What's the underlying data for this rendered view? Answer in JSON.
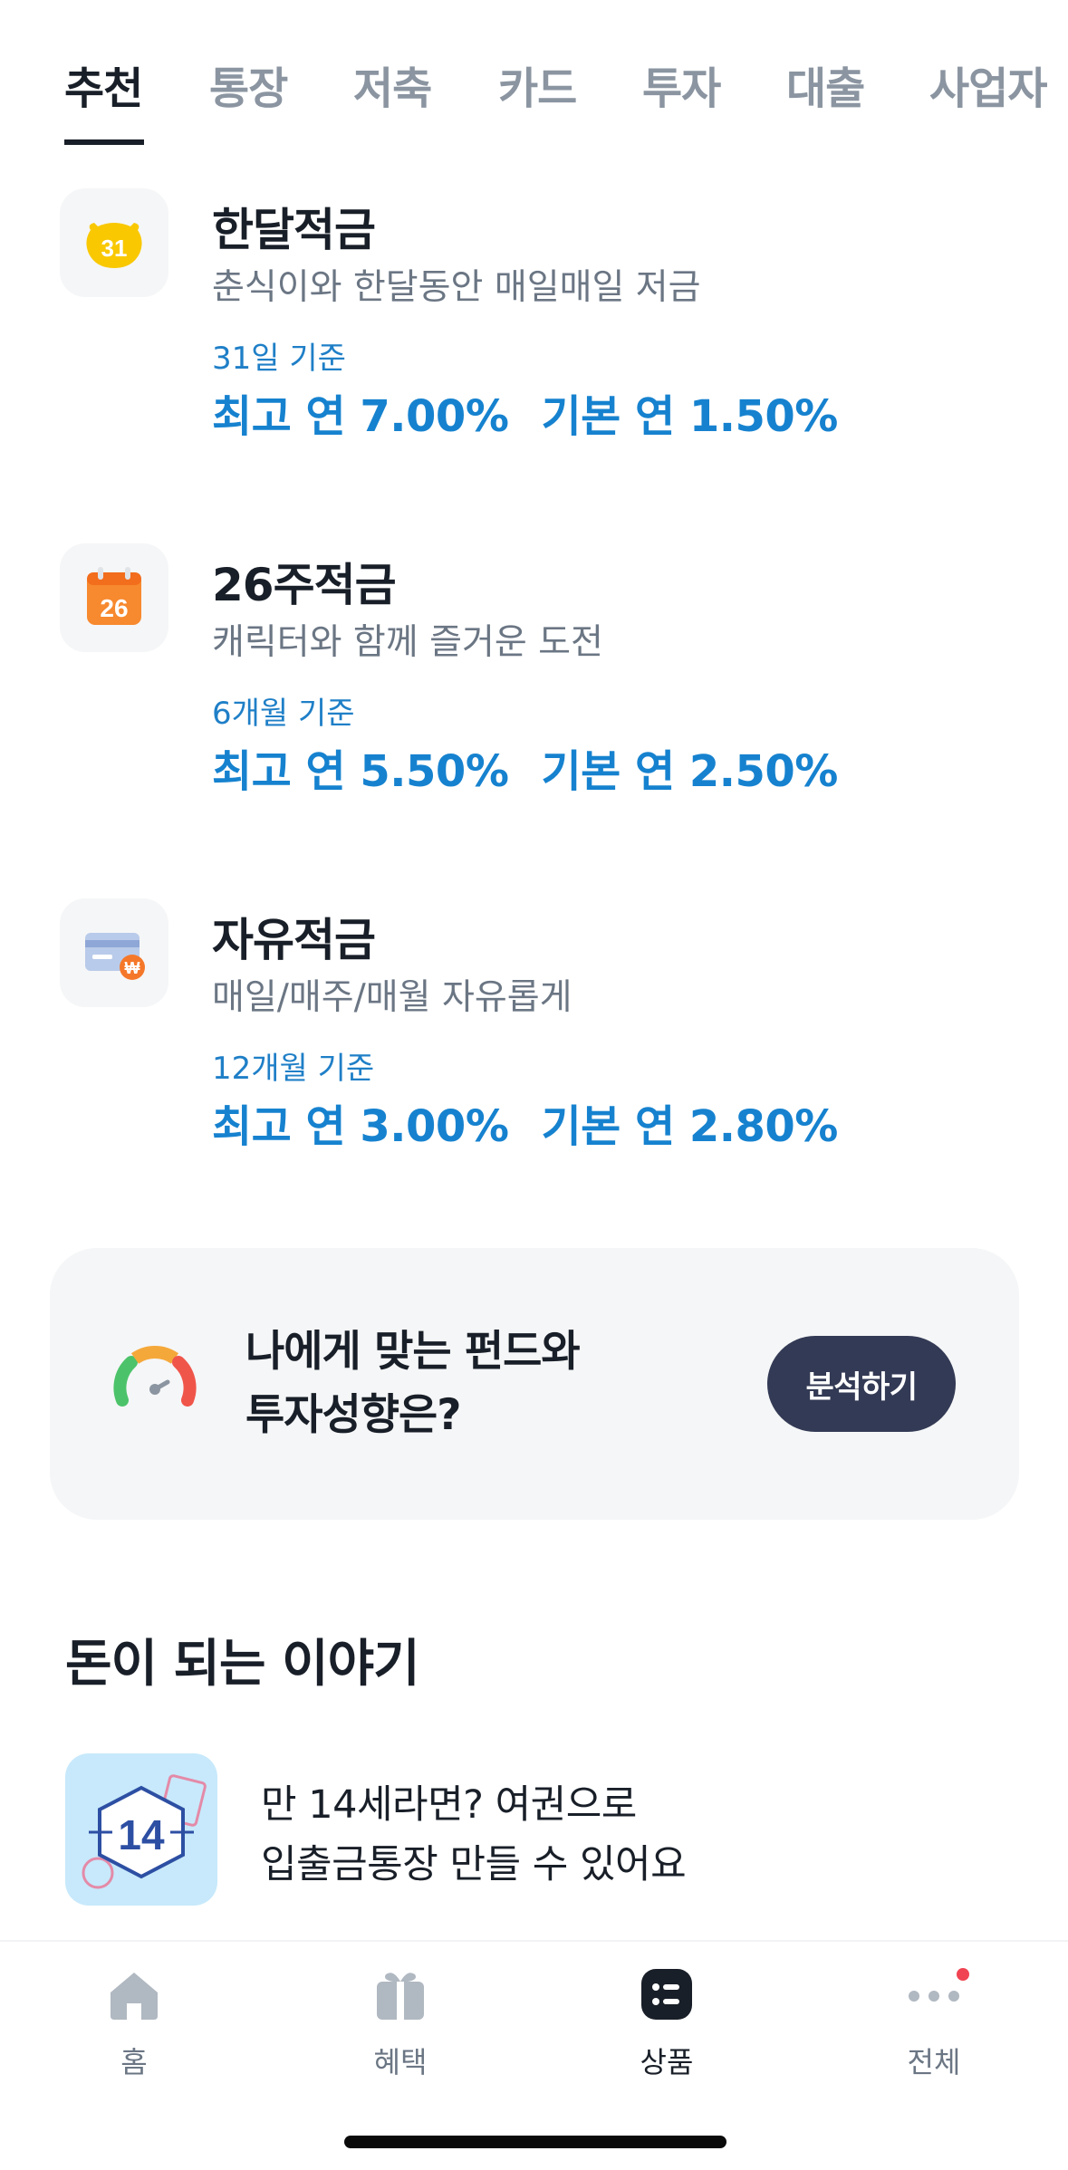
{
  "tabs": [
    "추천",
    "통장",
    "저축",
    "카드",
    "투자",
    "대출",
    "사업자"
  ],
  "active_tab_index": 0,
  "products": [
    {
      "icon": "calendar-31-icon",
      "icon_text": "31",
      "title": "한달적금",
      "subtitle": "춘식이와 한달동안 매일매일 저금",
      "period": "31일 기준",
      "max_rate": "최고 연 7.00%",
      "base_rate": "기본 연 1.50%"
    },
    {
      "icon": "calendar-26-icon",
      "icon_text": "26",
      "title": "26주적금",
      "subtitle": "캐릭터와 함께 즐거운 도전",
      "period": "6개월 기준",
      "max_rate": "최고 연 5.50%",
      "base_rate": "기본 연 2.50%"
    },
    {
      "icon": "card-won-icon",
      "icon_text": "₩",
      "title": "자유적금",
      "subtitle": "매일/매주/매월 자유롭게",
      "period": "12개월 기준",
      "max_rate": "최고 연 3.00%",
      "base_rate": "기본 연 2.80%"
    }
  ],
  "analysis": {
    "icon": "gauge-icon",
    "line1": "나에게 맞는 펀드와",
    "line2": "투자성향은?",
    "button": "분석하기"
  },
  "stories": {
    "title": "돈이 되는 이야기",
    "items": [
      {
        "thumb_icon": "passport-14-icon",
        "thumb_text": "14",
        "line1": "만 14세라면? 여권으로",
        "line2": "입출금통장 만들 수 있어요"
      }
    ]
  },
  "bottom_nav": [
    {
      "label": "홈",
      "icon": "home-icon"
    },
    {
      "label": "혜택",
      "icon": "gift-icon"
    },
    {
      "label": "상품",
      "icon": "list-icon"
    },
    {
      "label": "전체",
      "icon": "more-dots-icon"
    }
  ],
  "active_nav_index": 2,
  "colors": {
    "accent_blue": "#1682cf",
    "button_navy": "#333a55",
    "card_bg": "#f5f6f7",
    "notification_dot": "#f04452"
  }
}
